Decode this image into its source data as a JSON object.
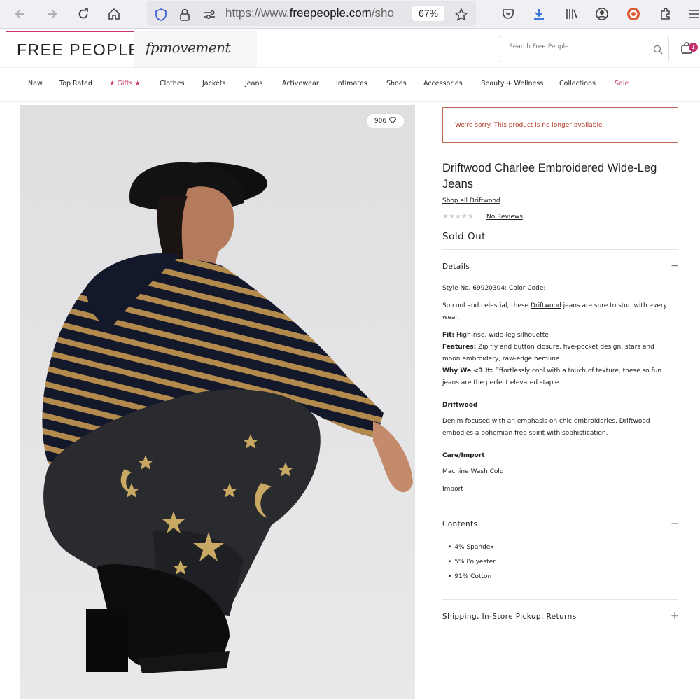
{
  "browser": {
    "url_prefix": "https://www.",
    "url_domain": "freepeople.com",
    "url_suffix": "/sho",
    "zoom": "67%"
  },
  "site": {
    "logo": "FREE PEOPLE",
    "fp_movement_logo": "fpmovement",
    "search_placeholder": "Search Free People",
    "bag_count": "1"
  },
  "nav": {
    "items": [
      "New",
      "Top Rated",
      "★ Gifts ★",
      "Clothes",
      "Jackets",
      "Jeans",
      "Activewear",
      "Intimates",
      "Shoes",
      "Accessories",
      "Beauty + Wellness",
      "Collections",
      "Sale"
    ]
  },
  "product": {
    "like_count": "906",
    "notice": "We're sorry. This product is no longer available.",
    "title": "Driftwood Charlee Embroidered Wide-Leg Jeans",
    "brand_link": "Shop all Driftwood",
    "rating_stars": "★★★★★",
    "reviews": "No Reviews",
    "status": "Sold Out"
  },
  "details": {
    "heading": "Details",
    "toggle": "−",
    "style_no": "Style No. 69920304; Color Code:",
    "intro_before": "So cool and celestial, these ",
    "intro_link": "Driftwood",
    "intro_after": " jeans are sure to stun with every wear.",
    "fit_label": "Fit:",
    "fit": " High-rise, wide-leg silhouette",
    "features_label": "Features:",
    "features": " Zip fly and button closure, five-pocket design, stars and moon embroidery, raw-edge hemline",
    "why_label": "Why We <3 It:",
    "why": " Effortlessly cool with a touch of texture, these so fun jeans are the perfect elevated staple.",
    "brand_heading": "Driftwood",
    "brand_text": "Denim-focused with an emphasis on chic embroideries, Driftwood embodies a bohemian free spirit with sophistication.",
    "care_heading": "Care/Import",
    "care_wash": "Machine Wash Cold",
    "care_import": "Import"
  },
  "contents": {
    "heading": "Contents",
    "toggle": "−",
    "items": [
      "4% Spandex",
      "5% Polyester",
      "91% Cotton"
    ]
  },
  "shipping": {
    "heading": "Shipping, In-Store Pickup, Returns",
    "toggle": "+"
  },
  "colors": {
    "brand_pink": "#c4346c",
    "notice_red": "#b03a26",
    "sweater_navy": "#14182b",
    "stripe_tan": "#b38a4e",
    "jeans_black": "#2a2b2e"
  }
}
